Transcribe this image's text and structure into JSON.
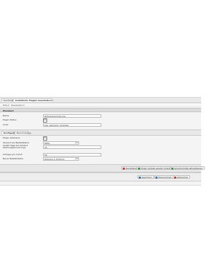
{
  "tabs": [
    {
      "label": "Dashboard",
      "active": false
    },
    {
      "label": "Installierte Plugins bearbeiten",
      "active": true,
      "close": "×"
    }
  ],
  "breadcrumb": {
    "items": [
      "Hilfe ▾",
      "Bearbeiten ▾"
    ]
  },
  "section": {
    "title": "Standard"
  },
  "general": {
    "name_label": "Name",
    "name_value": "Zahlungserinnerung",
    "status_label": "Plugin Status",
    "status_checked": "☒",
    "code_label": "Code",
    "code_value": "pse_payment_reminder"
  },
  "subtabs": [
    {
      "label": "Konfiguration",
      "active": true
    },
    {
      "label": "Beschreibung",
      "active": false
    }
  ],
  "config": {
    "active_label": "Plugin aktivieren",
    "active_checked": "☒",
    "send_status_label": "Versand bei Bestellstatus",
    "send_status_value": "Offen",
    "days_label": "Anzahl Tage bis Versand (Zahlungserinnerung)",
    "days_value": "10",
    "amount_label": "Anfrage pro Aufruf",
    "amount_value": "50",
    "new_status_label": "Neuer Bestellstatus",
    "new_status_value": "Zahlung in Prüfung"
  },
  "actions": {
    "deinstall": "Deinstallieren",
    "update": "Plugin Update wieder hinzufügen",
    "translate": "Sprachinhalte aktualisieren"
  },
  "footer": {
    "save": "Speichern",
    "save_close": "Übernehmen",
    "cancel": "Abbrechen"
  },
  "colors": {
    "accent_green": "#3a9a3a",
    "accent_blue": "#3a6fb0",
    "accent_red": "#c04040"
  }
}
